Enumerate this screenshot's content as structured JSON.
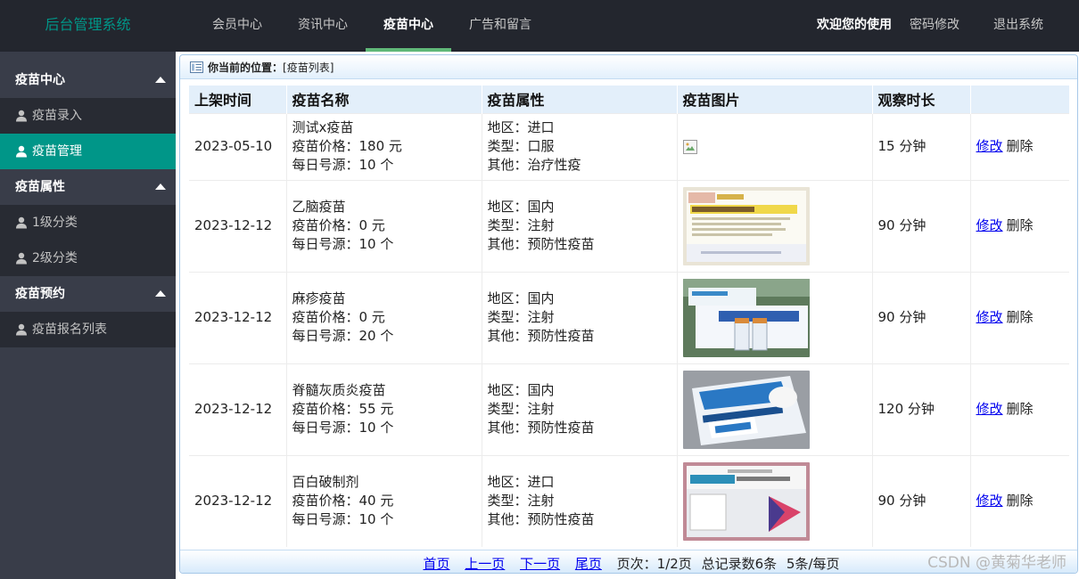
{
  "brand": "后台管理系统",
  "topnav": [
    "会员中心",
    "资讯中心",
    "疫苗中心",
    "广告和留言"
  ],
  "topright": {
    "welcome": "欢迎您的使用",
    "password": "密码修改",
    "logout": "退出系统"
  },
  "sidebar": {
    "groups": [
      {
        "title": "疫苗中心",
        "items": [
          "疫苗录入",
          "疫苗管理"
        ]
      },
      {
        "title": "疫苗属性",
        "items": [
          "1级分类",
          "2级分类"
        ]
      },
      {
        "title": "疫苗预约",
        "items": [
          "疫苗报名列表"
        ]
      }
    ]
  },
  "breadcrumb": {
    "label": "你当前的位置：",
    "value": "[疫苗列表]"
  },
  "table": {
    "headers": [
      "上架时间",
      "疫苗名称",
      "疫苗属性",
      "疫苗图片",
      "观察时长",
      ""
    ],
    "rows": [
      {
        "date": "2023-05-10",
        "name": "测试x疫苗",
        "price": "疫苗价格：180 元",
        "quota": "每日号源：10 个",
        "region": "地区：进口",
        "type": "类型：口服",
        "other": "其他：治疗性疫",
        "duration": "15 分钟"
      },
      {
        "date": "2023-12-12",
        "name": "乙脑疫苗",
        "price": "疫苗价格：0 元",
        "quota": "每日号源：10 个",
        "region": "地区：国内",
        "type": "类型：注射",
        "other": "其他：预防性疫苗",
        "duration": "90 分钟"
      },
      {
        "date": "2023-12-12",
        "name": "麻疹疫苗",
        "price": "疫苗价格：0 元",
        "quota": "每日号源：20 个",
        "region": "地区：国内",
        "type": "类型：注射",
        "other": "其他：预防性疫苗",
        "duration": "90 分钟"
      },
      {
        "date": "2023-12-12",
        "name": "脊髓灰质炎疫苗",
        "price": "疫苗价格：55 元",
        "quota": "每日号源：10 个",
        "region": "地区：国内",
        "type": "类型：注射",
        "other": "其他：预防性疫苗",
        "duration": "120 分钟"
      },
      {
        "date": "2023-12-12",
        "name": "百白破制剂",
        "price": "疫苗价格：40 元",
        "quota": "每日号源：10 个",
        "region": "地区：进口",
        "type": "类型：注射",
        "other": "其他：预防性疫苗",
        "duration": "90 分钟"
      }
    ],
    "edit_label": "修改",
    "delete_label": "删除"
  },
  "pager": {
    "first": "首页",
    "prev": "上一页",
    "next": "下一页",
    "last": "尾页",
    "page_info": "页次：1/2页",
    "total": "总记录数6条",
    "per_page": "5条/每页"
  },
  "watermark": "CSDN @黄菊华老师",
  "colors": {
    "topbar": "#23262e",
    "sidebar": "#393d49",
    "active": "#009688",
    "accent": "#5fb878"
  }
}
